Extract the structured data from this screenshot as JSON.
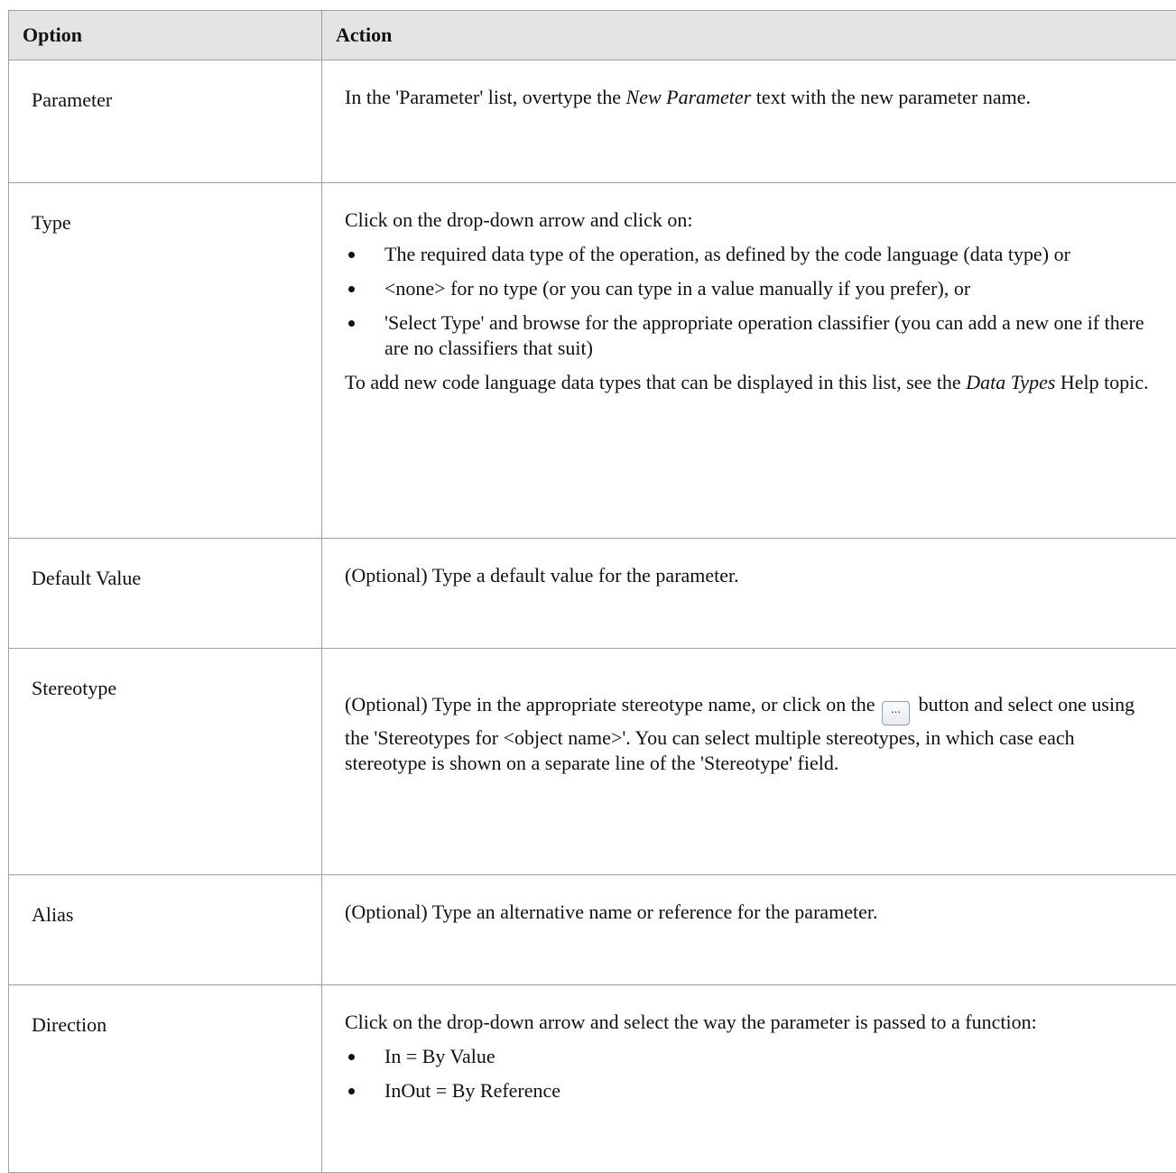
{
  "table": {
    "headers": {
      "option": "Option",
      "action": "Action"
    },
    "parameter": {
      "option": "Parameter",
      "text_before": "In the 'Parameter' list, overtype the ",
      "text_italic": "New Parameter",
      "text_after": " text with the new parameter name."
    },
    "type": {
      "option": "Type",
      "intro": "Click on the drop-down arrow and click on:",
      "bullets": [
        "The required data type of the operation, as defined by the code language (data type) or",
        "<none> for no type (or you can type in a value manually if you prefer), or",
        "'Select Type' and browse for the appropriate operation classifier (you can add a new one if there are no classifiers that suit)"
      ],
      "outro_before": "To add new code language data types that can be displayed in this list, see the ",
      "outro_italic": "Data Types",
      "outro_after": " Help topic."
    },
    "default_value": {
      "option": "Default Value",
      "text": "(Optional) Type a default value for the parameter."
    },
    "stereotype": {
      "option": "Stereotype",
      "text_before": "(Optional) Type in the appropriate stereotype name, or click on the ",
      "button_glyph": "...",
      "text_after": " button and select one using the 'Stereotypes for <object name>'. You can select multiple stereotypes, in which case each stereotype is shown on a separate line of the 'Stereotype' field."
    },
    "alias": {
      "option": "Alias",
      "text": "(Optional) Type an alternative name or reference for the parameter."
    },
    "direction": {
      "option": "Direction",
      "intro": "Click on the drop-down arrow and select the way the parameter is passed to a function:",
      "bullets": [
        "In = By Value",
        "InOut = By Reference"
      ]
    }
  }
}
